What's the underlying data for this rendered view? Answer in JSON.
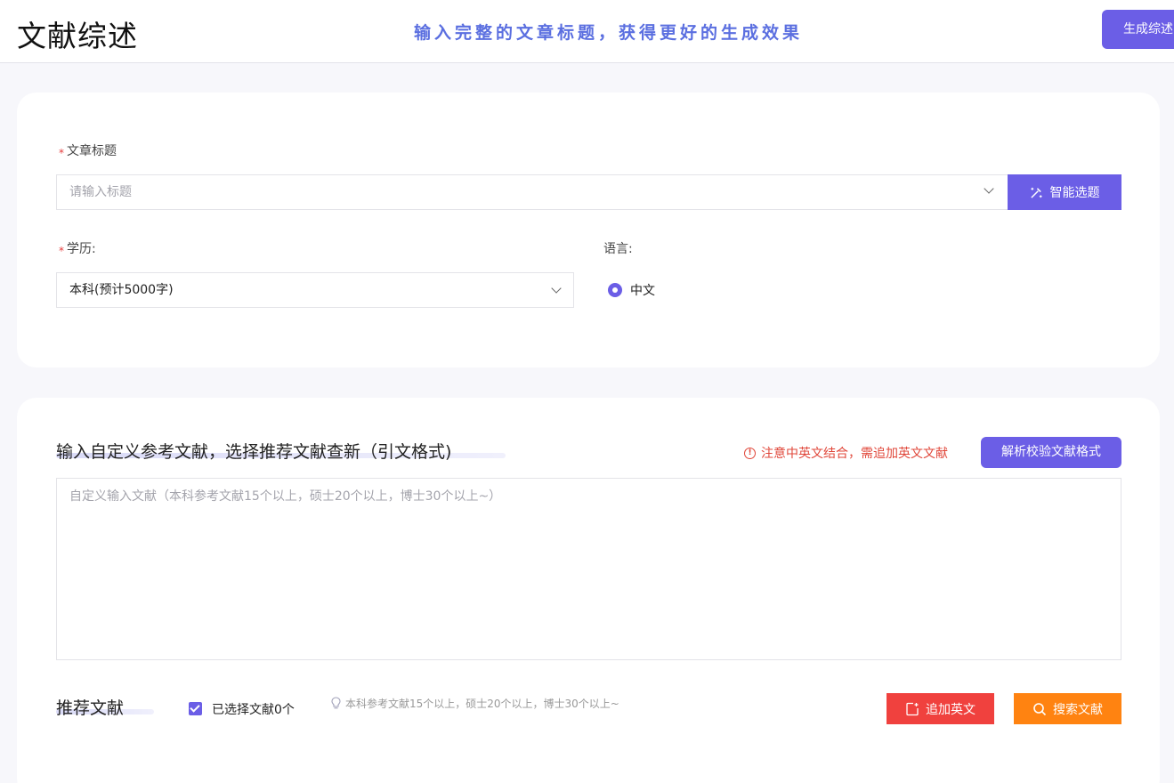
{
  "header": {
    "title": "文献综述",
    "slogan": "输入完整的文章标题，获得更好的生成效果",
    "generate_button": "生成综述"
  },
  "form": {
    "title_label": "文章标题",
    "title_placeholder": "请输入标题",
    "smart_button": "智能选题",
    "degree_label": "学历:",
    "degree_value": "本科(预计5000字)",
    "language_label": "语言:",
    "language_option": "中文"
  },
  "references": {
    "section_title": "输入自定义参考文献，选择推荐文献查新（引文格式)",
    "warning": "注意中英文结合，需追加英文文献",
    "parse_button": "解析校验文献格式",
    "textarea_placeholder": "自定义输入文献（本科参考文献15个以上，硕士20个以上，博士30个以上~）"
  },
  "recommend": {
    "section_title": "推荐文献",
    "selected_label": "已选择文献0个",
    "tip": "本科参考文献15个以上，硕士20个以上，博士30个以上~",
    "add_english_button": "追加英文",
    "search_button": "搜索文献"
  },
  "colors": {
    "accent": "#6b5ee6",
    "warning_red": "#e0473a",
    "add_button_red": "#f0413e",
    "search_button_orange": "#ff8311",
    "slogan_blue": "#5b6fe0"
  }
}
